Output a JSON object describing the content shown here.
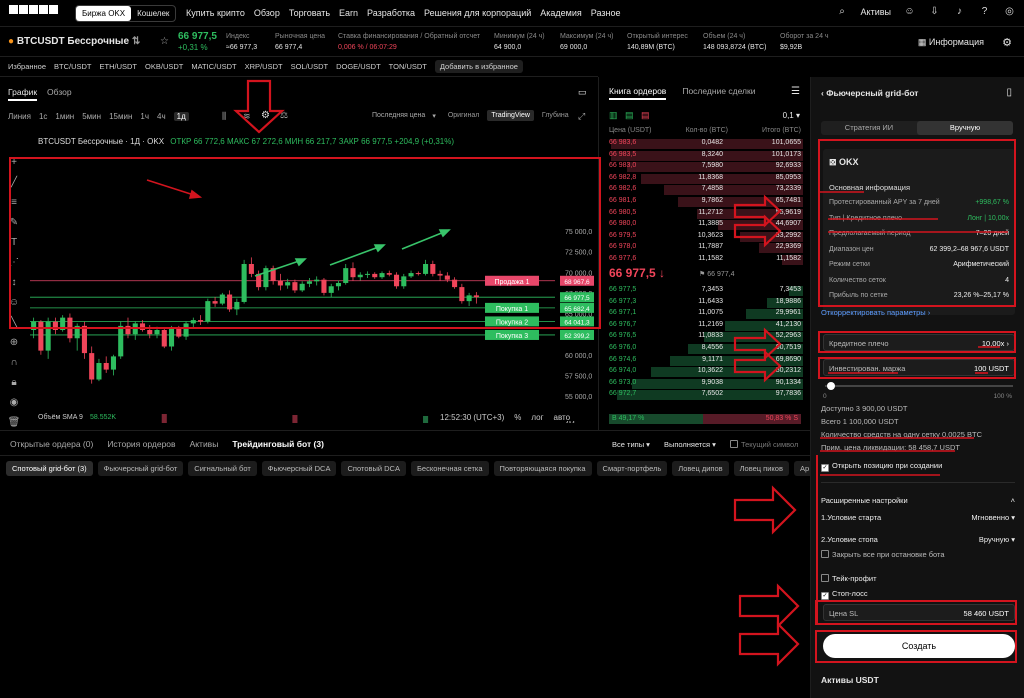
{
  "topnav": {
    "seg": [
      "Биржа OKX",
      "Кошелек"
    ],
    "menu": [
      "Купить крипто",
      "Обзор",
      "Торговать",
      "Earn",
      "Разработка",
      "Решения для корпораций",
      "Академия",
      "Разное"
    ],
    "assets": "Активы"
  },
  "ticker": {
    "name": "BTCUSDT Бессрочные",
    "price": "66 977,5",
    "change": "+0,31 %",
    "stats": [
      {
        "label": "Индекс",
        "value": "≈66 977,3"
      },
      {
        "label": "Рыночная цена",
        "value": "66 977,4"
      },
      {
        "label": "Ставка финансирования / Обратный отсчет",
        "value": "0,006 % / 06:07:29"
      },
      {
        "label": "Минимум (24 ч)",
        "value": "64 900,0"
      },
      {
        "label": "Максимум (24 ч)",
        "value": "69 000,0"
      },
      {
        "label": "Открытый интерес",
        "value": "140,89M (BTC)"
      },
      {
        "label": "Объем (24 ч)",
        "value": "148 093,8724 (BTC)"
      },
      {
        "label": "Оборот за 24 ч",
        "value": "$9,92B"
      }
    ],
    "info": "Информация"
  },
  "favbar": [
    "Избранное",
    "BTC/USDT",
    "ETH/USDT",
    "OKB/USDT",
    "MATIC/USDT",
    "XRP/USDT",
    "SOL/USDT",
    "DOGE/USDT",
    "TON/USDT"
  ],
  "favbar_add": "Добавить в избранное",
  "chart": {
    "tabs": [
      "График",
      "Обзор"
    ],
    "timeframes": [
      "Линия",
      "1с",
      "1мин",
      "5мин",
      "15мин",
      "1ч",
      "4ч",
      "1д"
    ],
    "active_tf": "1д",
    "price_mode": "Последняя цена",
    "views": [
      "Оригинал",
      "TradingView",
      "Глубина"
    ],
    "title_name": "BTCUSDT Бессрочные · 1Д · OKX",
    "ohlc": "ОТКР 66 772,6   МАКС 67 272,6   МИН 66 217,7   ЗАКР 66 977,5   +204,9 (+0,31%)",
    "volume_label": "Объём SMA 9",
    "volume_value": "58.552K",
    "time": "12:52:30 (UTC+3)",
    "scale_opts": [
      "%",
      "лог",
      "авто"
    ],
    "time_labels": [
      "22",
      "Май",
      "8",
      "15",
      "22",
      "Июн",
      "8",
      "15",
      "22"
    ],
    "price_labels": [
      "75 000,0",
      "72 500,0",
      "70 000,0",
      "67 500,0",
      "65 000,0",
      "62 500,0",
      "60 000,0",
      "57 500,0",
      "55 000,0"
    ],
    "vol_labels": [
      "4M",
      "2M"
    ],
    "levels": [
      {
        "label": "Продажа 1",
        "price": "68 967,6",
        "color": "#e8476a"
      },
      {
        "label": "",
        "price": "66 977,5",
        "color": "#2ebd5f"
      },
      {
        "label": "Покупка 1",
        "price": "65 682,4",
        "color": "#2ebd5f"
      },
      {
        "label": "Покупка 2",
        "price": "64 041,3",
        "color": "#2ebd5f"
      },
      {
        "label": "Покупка 3",
        "price": "62 399,2",
        "color": "#2ebd5f"
      }
    ]
  },
  "chart_data": {
    "type": "candlestick",
    "title": "BTCUSDT Бессрочные · 1Д · OKX",
    "ylim": [
      55000,
      75000
    ],
    "candles": [
      [
        63000,
        64500,
        62000,
        64000
      ],
      [
        64000,
        64200,
        60000,
        60500
      ],
      [
        60500,
        64500,
        59500,
        64000
      ],
      [
        64000,
        64500,
        62500,
        63000
      ],
      [
        63000,
        64800,
        62800,
        64500
      ],
      [
        64500,
        65000,
        61500,
        62000
      ],
      [
        62000,
        63800,
        60500,
        63500
      ],
      [
        63500,
        64000,
        59500,
        60200
      ],
      [
        60200,
        61000,
        56500,
        57000
      ],
      [
        57000,
        59500,
        56800,
        59000
      ],
      [
        59000,
        59800,
        57800,
        58200
      ],
      [
        58200,
        60000,
        57500,
        59800
      ],
      [
        59800,
        64000,
        59500,
        63500
      ],
      [
        63500,
        64500,
        62000,
        62500
      ],
      [
        62500,
        64000,
        61800,
        63800
      ],
      [
        63800,
        64200,
        62800,
        63000
      ],
      [
        63000,
        63600,
        62000,
        62500
      ],
      [
        62500,
        63400,
        62000,
        63000
      ],
      [
        63000,
        63200,
        60800,
        61000
      ],
      [
        61000,
        63500,
        60500,
        63200
      ],
      [
        63200,
        63500,
        62000,
        62200
      ],
      [
        62200,
        64000,
        61800,
        63800
      ],
      [
        63800,
        64500,
        63300,
        64200
      ],
      [
        64200,
        64800,
        63600,
        64000
      ],
      [
        64000,
        66800,
        63800,
        66500
      ],
      [
        66500,
        67000,
        65800,
        66200
      ],
      [
        66200,
        67500,
        66000,
        67300
      ],
      [
        67300,
        67800,
        65200,
        65500
      ],
      [
        65500,
        66800,
        64800,
        66400
      ],
      [
        66400,
        71500,
        66200,
        71000
      ],
      [
        71000,
        71800,
        69400,
        69800
      ],
      [
        69800,
        70200,
        67800,
        68200
      ],
      [
        68200,
        70800,
        67800,
        70500
      ],
      [
        70500,
        70800,
        68500,
        69000
      ],
      [
        69000,
        69800,
        67800,
        68400
      ],
      [
        68400,
        69200,
        68000,
        68800
      ],
      [
        68800,
        69100,
        67500,
        67800
      ],
      [
        67800,
        68900,
        67600,
        68600
      ],
      [
        68600,
        69300,
        68200,
        68900
      ],
      [
        68900,
        69500,
        68400,
        69100
      ],
      [
        69100,
        69300,
        67200,
        67500
      ],
      [
        67500,
        68600,
        67000,
        68300
      ],
      [
        68300,
        69000,
        67800,
        68700
      ],
      [
        68700,
        71000,
        68500,
        70500
      ],
      [
        70500,
        71200,
        69000,
        69400
      ],
      [
        69400,
        70000,
        69000,
        69700
      ],
      [
        69700,
        70100,
        69300,
        69800
      ],
      [
        69800,
        70000,
        69200,
        69400
      ],
      [
        69400,
        70100,
        69200,
        69900
      ],
      [
        69900,
        70200,
        69500,
        69700
      ],
      [
        69700,
        70000,
        68000,
        68300
      ],
      [
        68300,
        69800,
        68000,
        69500
      ],
      [
        69500,
        70200,
        69300,
        69900
      ],
      [
        69900,
        70100,
        69600,
        69800
      ],
      [
        69800,
        71500,
        69600,
        71000
      ],
      [
        71000,
        71400,
        69500,
        69800
      ],
      [
        69800,
        70200,
        69000,
        69600
      ],
      [
        69600,
        70000,
        68800,
        69100
      ],
      [
        69100,
        69400,
        68000,
        68200
      ],
      [
        68200,
        68600,
        66200,
        66500
      ],
      [
        66500,
        67500,
        65900,
        67200
      ],
      [
        67200,
        67600,
        66200,
        66977
      ]
    ]
  },
  "orderbook": {
    "tabs": [
      "Книга ордеров",
      "Последние сделки"
    ],
    "headers": [
      "Цена (USDT)",
      "Кол-во (BTC)",
      "Итого (BTC)"
    ],
    "asks": [
      [
        "66 983,6",
        "0,0482",
        "101,0655"
      ],
      [
        "66 983,5",
        "8,3240",
        "101,0173"
      ],
      [
        "66 983,0",
        "7,5980",
        "92,6933"
      ],
      [
        "66 982,8",
        "11,8368",
        "85,0953"
      ],
      [
        "66 982,6",
        "7,4858",
        "73,2339"
      ],
      [
        "66 981,6",
        "9,7862",
        "65,7481"
      ],
      [
        "66 980,5",
        "11,2712",
        "55,9619"
      ],
      [
        "66 980,0",
        "11,3885",
        "44,6907"
      ],
      [
        "66 979,5",
        "10,3623",
        "33,2992"
      ],
      [
        "66 978,0",
        "11,7887",
        "22,9369"
      ],
      [
        "66 977,6",
        "11,1582",
        "11,1582"
      ]
    ],
    "mid_price": "66 977,5",
    "mid_sub": "66 977,4",
    "bids": [
      [
        "66 977,5",
        "7,3453",
        "7,3453"
      ],
      [
        "66 977,3",
        "11,6433",
        "18,9886"
      ],
      [
        "66 977,1",
        "11,0075",
        "29,9961"
      ],
      [
        "66 976,7",
        "11,2169",
        "41,2130"
      ],
      [
        "66 976,5",
        "11,0833",
        "52,2963"
      ],
      [
        "66 976,0",
        "8,4556",
        "60,7519"
      ],
      [
        "66 974,6",
        "9,1171",
        "69,8690"
      ],
      [
        "66 974,0",
        "10,3622",
        "80,2312"
      ],
      [
        "66 973,0",
        "9,9038",
        "90,1334"
      ],
      [
        "66 972,7",
        "7,6502",
        "97,7836"
      ]
    ],
    "ratio_buy": "49,17 %",
    "ratio_sell": "50,83 %",
    "ratio_buy_pct": 49.17,
    "precision": "0,1"
  },
  "orders": {
    "tabs": [
      "Открытые ордера (0)",
      "История ордеров",
      "Активы",
      "Трейдинговый бот (3)"
    ],
    "filters": [
      "Все типы",
      "Выполняется",
      "Текущий символ"
    ],
    "bots": [
      "Спотовый grid-бот (3)",
      "Фьючерсный grid-бот",
      "Сигнальный бот",
      "Фьючерсный DCA",
      "Спотовый DCA",
      "Бесконечная сетка",
      "Повторяющаяся покупка",
      "Смарт-портфель",
      "Ловец дипов",
      "Ловец пиков",
      "Ар"
    ]
  },
  "botpanel": {
    "title": "Фьючерсный grid-бот",
    "modes": [
      "Стратегия ИИ",
      "Вручную"
    ],
    "brand": "OKX",
    "section": "Основная информация",
    "rows": [
      {
        "k": "Протестированный APY за 7 дней",
        "v": "+998,67 %"
      },
      {
        "k": "Тип | Кредитное плечо",
        "v": "Лонг | 10,00x"
      },
      {
        "k": "Предполагаемый период",
        "v": "7–20 дней"
      },
      {
        "k": "Диапазон цен",
        "v": "62 399,2–68 967,6 USDT"
      },
      {
        "k": "Режим сетки",
        "v": "Арифметический"
      },
      {
        "k": "Количество сеток",
        "v": "4"
      },
      {
        "k": "Прибыль по сетке",
        "v": "23,26 %–25,17 %"
      }
    ],
    "adjust": "Откорректировать параметры",
    "leverage_label": "Кредитное плечо",
    "leverage_value": "10,00x",
    "margin_label": "Инвестирован. маржа",
    "margin_value": "100",
    "margin_unit": "USDT",
    "slider_min": "0",
    "slider_max": "100 %",
    "slider_pct": 3,
    "available": "Доступно 3 900,00 USDT",
    "total": "Всего 1 100,000 USDT",
    "per_grid": "Количество средств на одну сетку 0,0025 BTC",
    "liq": "Прим. цена ликвидации: 58 458,7 USDT",
    "open_pos": "Открыть позицию при создании",
    "adv": "Расширенные настройки",
    "start_cond": "1.Условие старта",
    "start_val": "Мгновенно",
    "stop_cond": "2.Условие стопа",
    "stop_val": "Вручную",
    "close_all": "Закрыть все при остановке бота",
    "tp": "Тейк-профит",
    "sl": "Стоп-лосс",
    "sl_label": "Цена SL",
    "sl_value": "58 460",
    "sl_unit": "USDT",
    "create": "Создать",
    "assets": "Активы USDT"
  }
}
